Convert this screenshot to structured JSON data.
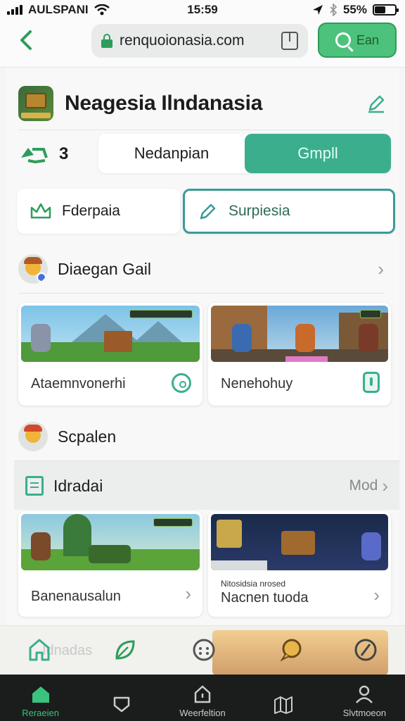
{
  "status": {
    "carrier": "AULSPANI",
    "time": "15:59",
    "battery_percent": "55%",
    "battery_level": 0.55
  },
  "browser": {
    "url": "renquoionasia.com",
    "search_label": "Ean"
  },
  "header": {
    "title": "Neagesia Ilndanasia"
  },
  "segmented": {
    "number": "3",
    "options": [
      "Nedanpian",
      "Gmpll"
    ],
    "selected": 1
  },
  "chips": [
    {
      "label": "Fderpaia"
    },
    {
      "label": "Surpiesia"
    }
  ],
  "sections": {
    "first": {
      "title": "Diaegan Gail"
    },
    "second": {
      "title": "Scpalen"
    },
    "third": {
      "title": "Idradai",
      "more": "Mod"
    }
  },
  "cards": [
    {
      "caption": "Ataemnvonerhi"
    },
    {
      "caption": "Nenehohuy"
    },
    {
      "caption": "Banenausalun"
    },
    {
      "subcaption": "Nitosidsia nrosed",
      "caption": "Nacnen tuoda"
    }
  ],
  "floatbar": {
    "ghost_text": "Idnadas"
  },
  "tabbar": {
    "tabs": [
      {
        "label": "Reraeien",
        "icon": "home-icon"
      },
      {
        "label": "",
        "icon": "shield-icon"
      },
      {
        "label": "Weerfeltion",
        "icon": "house-outline-icon"
      },
      {
        "label": "",
        "icon": "map-icon"
      },
      {
        "label": "Slvtmoeon",
        "icon": "profile-icon"
      }
    ],
    "active": 0
  },
  "colors": {
    "accent": "#3bae8e",
    "green": "#4cc27c",
    "tabbar_bg": "#1a1d1c"
  }
}
